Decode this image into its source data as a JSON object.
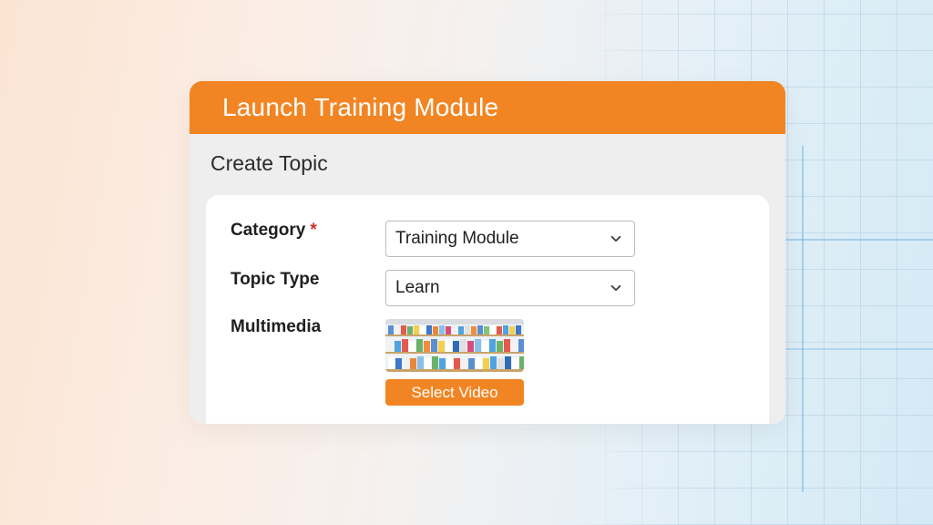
{
  "window": {
    "title": "Launch Training Module"
  },
  "section": {
    "title": "Create Topic"
  },
  "form": {
    "category": {
      "label": "Category",
      "required_mark": "*",
      "value": "Training Module"
    },
    "topic_type": {
      "label": "Topic Type",
      "value": "Learn"
    },
    "multimedia": {
      "label": "Multimedia",
      "button_label": "Select Video",
      "thumbnail": "store-shelves-thumbnail"
    }
  },
  "icons": {
    "dropdown": "chevron-down-icon"
  },
  "colors": {
    "accent": "#f28523",
    "required": "#d42c2c",
    "panel": "#eeeeee",
    "card": "#ffffff"
  }
}
